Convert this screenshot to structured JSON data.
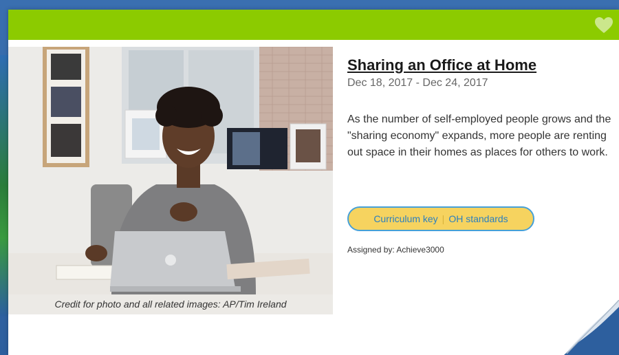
{
  "card": {
    "title": "Sharing an Office at Home",
    "date_range": "Dec 18, 2017 - Dec 24, 2017",
    "description": "As the number of self-employed people grows and the \"sharing economy\" expands, more people are renting out space in their homes as places for others to work.",
    "photo_caption": "Credit for photo and all related images: AP/Tim Ireland",
    "curriculum_key_label": "Curriculum key",
    "separator": "|",
    "oh_standards_label": "OH standards",
    "assigned_by": "Assigned by: Achieve3000"
  },
  "colors": {
    "header_green": "#8ccb00",
    "pill_fill": "#f6d35f",
    "pill_border": "#46a0d8",
    "pill_text": "#2a7fc0"
  },
  "icons": {
    "favorite": "heart-icon",
    "page_curl": "page-curl-icon"
  }
}
